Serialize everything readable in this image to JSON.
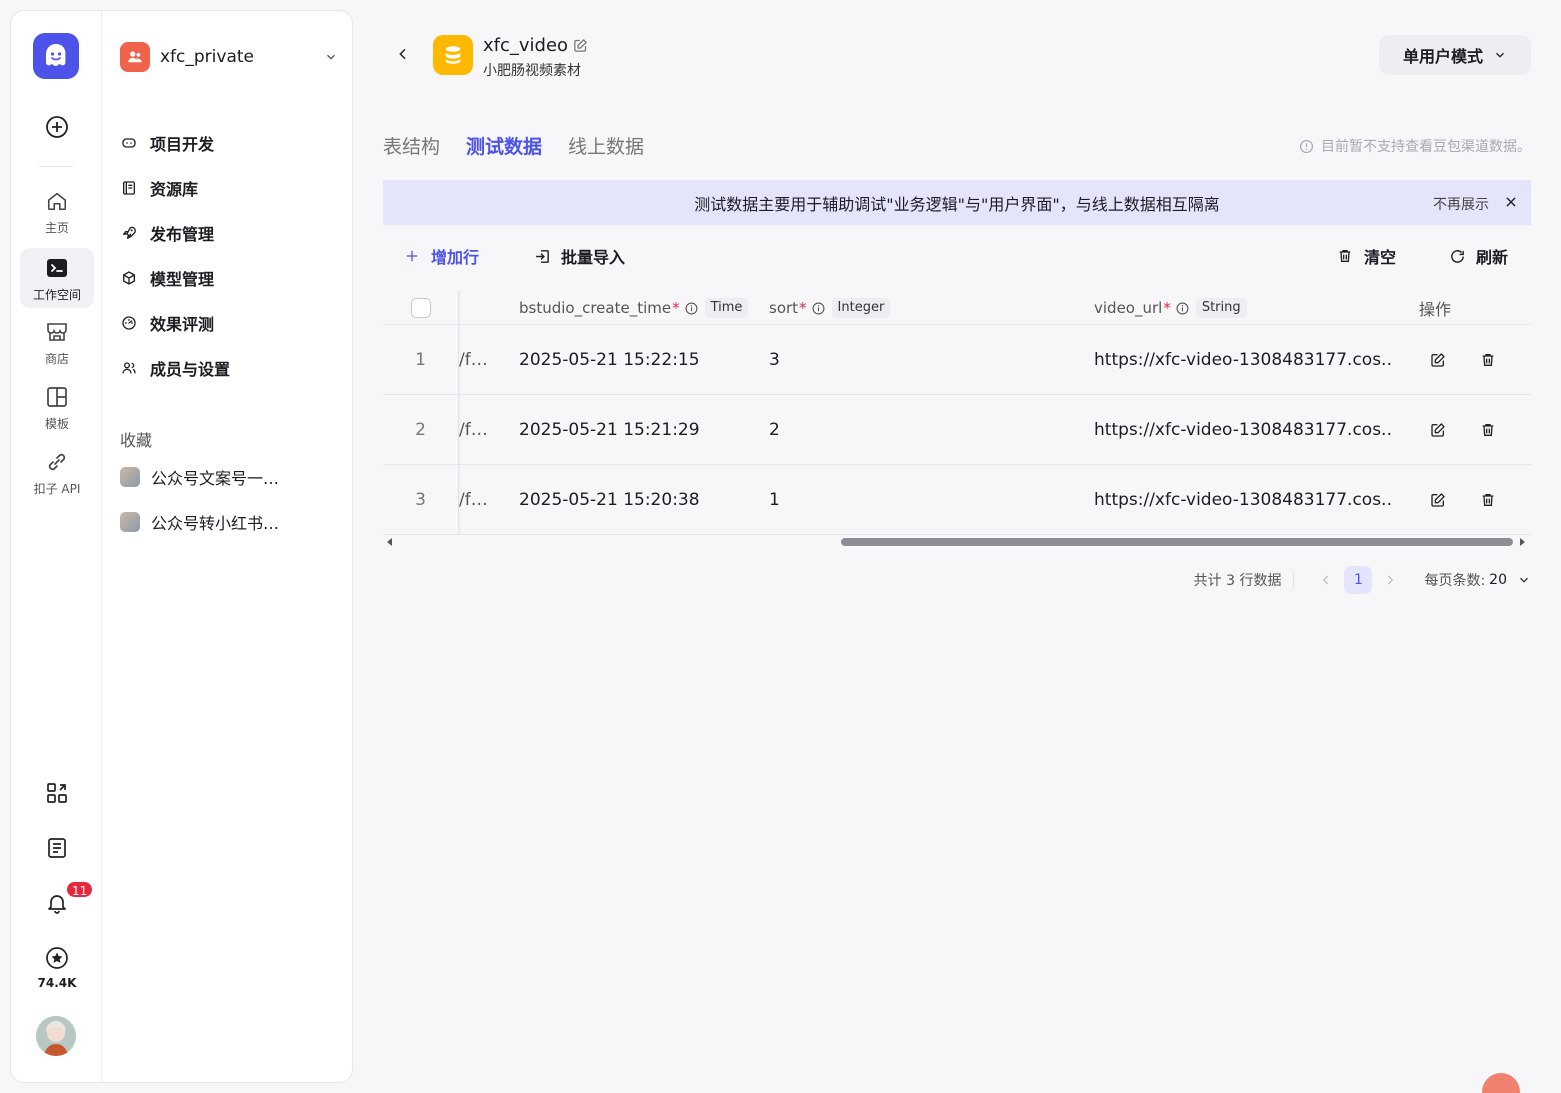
{
  "rail": {
    "items": [
      {
        "label": "主页",
        "icon": "home-icon"
      },
      {
        "label": "工作空间",
        "icon": "terminal-icon"
      },
      {
        "label": "商店",
        "icon": "store-icon"
      },
      {
        "label": "模板",
        "icon": "template-icon"
      },
      {
        "label": "扣子 API",
        "icon": "api-icon"
      }
    ],
    "notification_count": "11",
    "stars": "74.4K"
  },
  "sidebar": {
    "space_name": "xfc_private",
    "nav": [
      {
        "label": "项目开发"
      },
      {
        "label": "资源库"
      },
      {
        "label": "发布管理"
      },
      {
        "label": "模型管理"
      },
      {
        "label": "效果评测"
      },
      {
        "label": "成员与设置"
      }
    ],
    "favorites_title": "收藏",
    "favorites": [
      {
        "label": "公众号文案号一…"
      },
      {
        "label": "公众号转小红书…"
      }
    ]
  },
  "header": {
    "db_name": "xfc_video",
    "db_desc": "小肥肠视频素材",
    "mode_label": "单用户模式"
  },
  "tabs": [
    {
      "label": "表结构"
    },
    {
      "label": "测试数据"
    },
    {
      "label": "线上数据"
    }
  ],
  "notice": "目前暂不支持查看豆包渠道数据。",
  "banner": {
    "text": "测试数据主要用于辅助调试\"业务逻辑\"与\"用户界面\"，与线上数据相互隔离",
    "hide_label": "不再展示"
  },
  "toolbar": {
    "add_row": "增加行",
    "batch_import": "批量导入",
    "clear": "清空",
    "refresh": "刷新"
  },
  "table": {
    "columns": [
      {
        "name": "bstudio_create_time",
        "required": "*",
        "type": "Time"
      },
      {
        "name": "sort",
        "required": "*",
        "type": "Integer"
      },
      {
        "name": "video_url",
        "required": "*",
        "type": "String"
      }
    ],
    "actions_header": "操作",
    "rows": [
      {
        "index": "1",
        "frozen": "/f…",
        "create_time": "2025-05-21 15:22:15",
        "sort": "3",
        "video_url": "https://xfc-video-1308483177.cos.…"
      },
      {
        "index": "2",
        "frozen": "/f…",
        "create_time": "2025-05-21 15:21:29",
        "sort": "2",
        "video_url": "https://xfc-video-1308483177.cos.…"
      },
      {
        "index": "3",
        "frozen": "/f…",
        "create_time": "2025-05-21 15:20:38",
        "sort": "1",
        "video_url": "https://xfc-video-1308483177.cos.…"
      }
    ]
  },
  "pagination": {
    "total": "共计 3 行数据",
    "current_page": "1",
    "page_size_label": "每页条数:",
    "page_size": "20"
  },
  "colors": {
    "accent": "#4d53e8",
    "banner_bg": "#e4e5fb",
    "db_icon": "#ffb800",
    "space_icon": "#f06249",
    "badge": "#e5283c"
  }
}
